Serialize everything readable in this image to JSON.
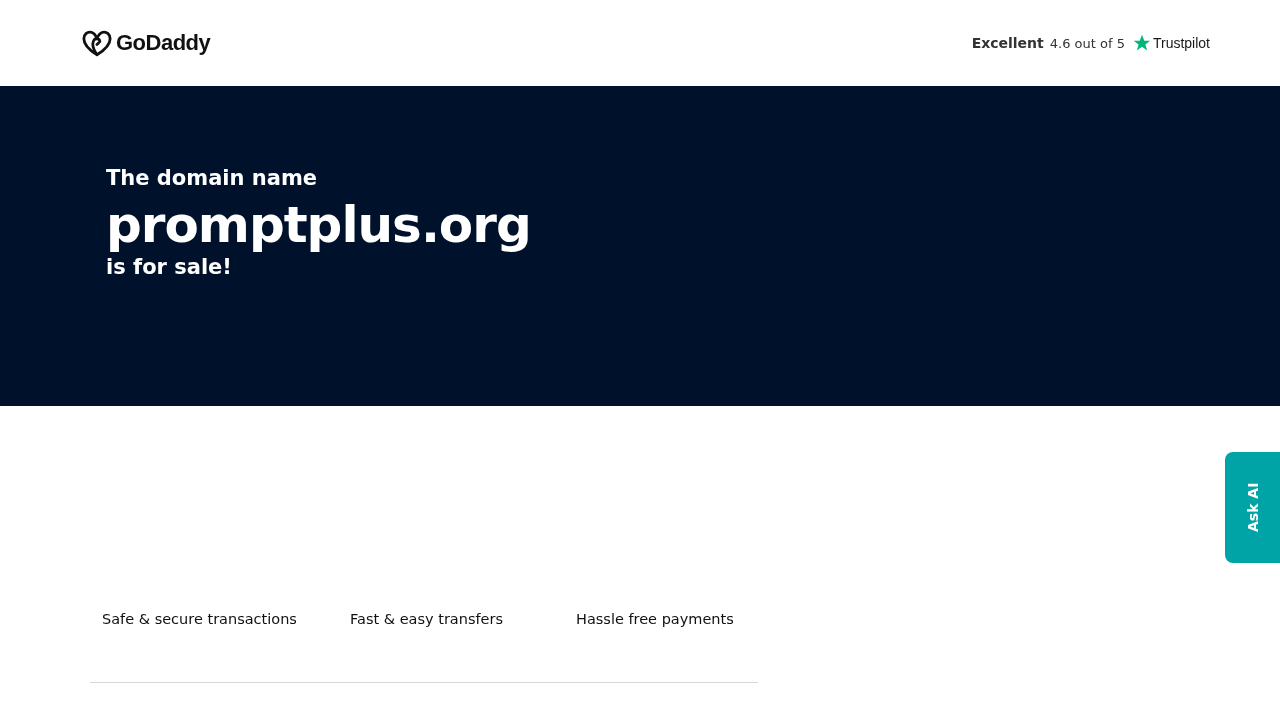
{
  "header": {
    "logo": "GoDaddy",
    "rating": {
      "label": "Excellent",
      "score": "4.6 out of 5",
      "brand": "Trustpilot"
    }
  },
  "hero": {
    "intro": "The domain name",
    "domain": "promptplus.org",
    "outro": "is for sale!"
  },
  "features": [
    "Safe & secure transactions",
    "Fast & easy transfers",
    "Hassle free payments"
  ],
  "ask_ai": {
    "label": "Ask AI"
  }
}
